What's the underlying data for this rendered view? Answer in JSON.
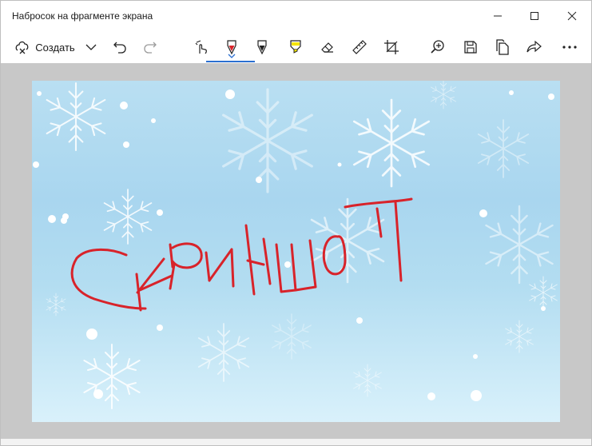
{
  "window": {
    "title": "Набросок на фрагменте экрана"
  },
  "toolbar": {
    "create_label": "Создать",
    "active_tool": "ballpoint-pen",
    "pen_color": "#d8232a",
    "highlighter_color": "#f5e400",
    "accent_color": "#2b6fd1"
  },
  "canvas": {
    "handwritten_text": "СКРИНШОТ",
    "background_colors": [
      "#b9dff2",
      "#d9f1fb"
    ]
  }
}
